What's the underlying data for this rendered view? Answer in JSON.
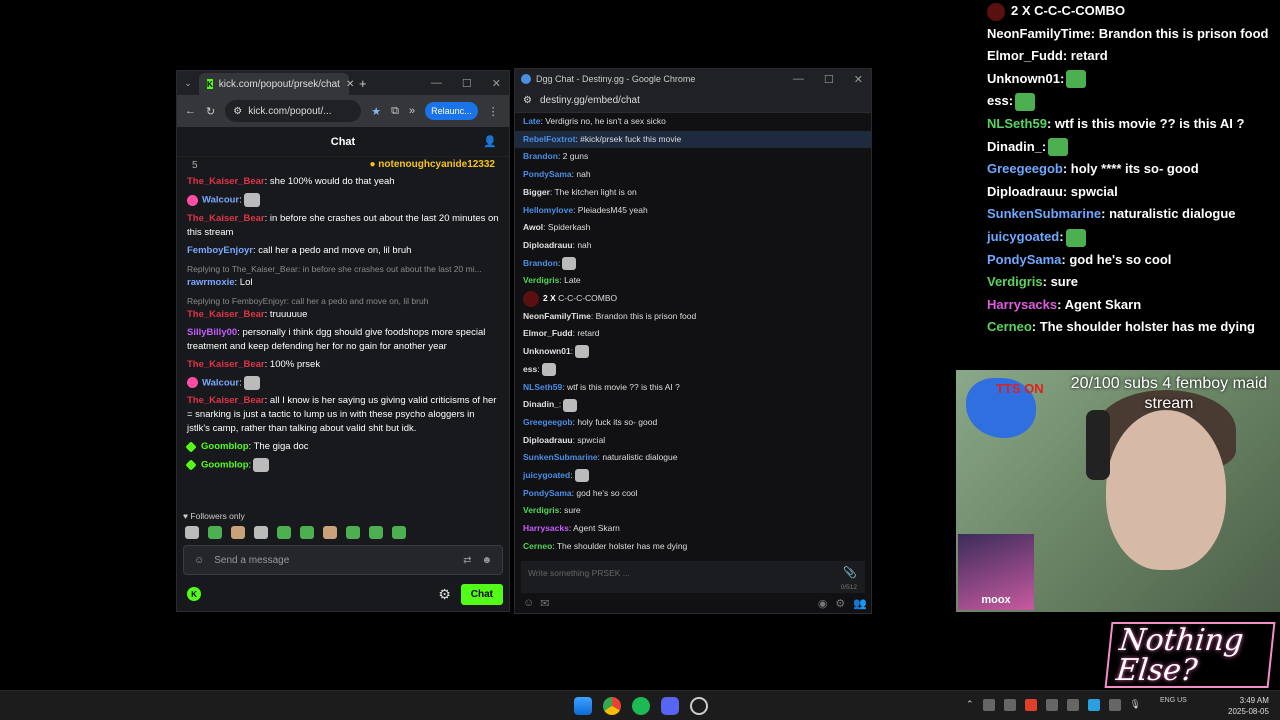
{
  "kick": {
    "tab_title": "kick.com/popout/prsek/chat",
    "url": "kick.com/popout/...",
    "relaunch_label": "Relaunc...",
    "chat_title": "Chat",
    "pinned_count": "5",
    "pinned_user": "notenoughcyanide12332",
    "messages": [
      {
        "user": "The_Kaiser_Bear",
        "text": ": she 100% would do that yeah",
        "color": "#e0334a",
        "reply": ""
      },
      {
        "user": "Walcour",
        "text": ":",
        "color": "#7aa8ff",
        "reply": ""
      },
      {
        "user": "The_Kaiser_Bear",
        "text": ": in before she crashes out about the last 20 minutes on this stream",
        "color": "#e0334a",
        "reply": ""
      },
      {
        "user": "FemboyEnjoyr",
        "text": ": call her a pedo and move on, lil bruh",
        "color": "#7aa8ff",
        "reply": ""
      },
      {
        "user": "rawrmoxie",
        "text": ": Lol",
        "color": "#7aa8ff",
        "reply": "Replying to The_Kaiser_Bear: in before she crashes out about the last 20 mi..."
      },
      {
        "user": "The_Kaiser_Bear",
        "text": ": truuuuue",
        "color": "#e0334a",
        "reply": "Replying to FemboyEnjoyr: call her a pedo and move on, lil bruh"
      },
      {
        "user": "SillyBilly00",
        "text": ": personally i think dgg should give foodshops more special treatment and keep defending her for no gain for another year",
        "color": "#c55cff",
        "reply": ""
      },
      {
        "user": "The_Kaiser_Bear",
        "text": ": 100% prsek",
        "color": "#e0334a",
        "reply": ""
      },
      {
        "user": "Walcour",
        "text": ":",
        "color": "#7aa8ff",
        "reply": ""
      },
      {
        "user": "The_Kaiser_Bear",
        "text": ": all I know is her saying us giving valid criticisms of her = snarking is just a tactic to lump us in with these psycho aloggers in jstlk's camp, rather than talking about valid shit but idk.",
        "color": "#e0334a",
        "reply": ""
      },
      {
        "user": "Goomblop",
        "text": ": The giga doc",
        "color": "#53fc18",
        "reply": ""
      },
      {
        "user": "Goomblop",
        "text": ":",
        "color": "#53fc18",
        "reply": ""
      }
    ],
    "followers_only": "Followers only",
    "input_placeholder": "Send a message",
    "chat_button": "Chat"
  },
  "dgg": {
    "window_title": "Dgg Chat - Destiny.gg - Google Chrome",
    "url": "destiny.gg/embed/chat",
    "messages": [
      {
        "user": "Late",
        "text": ": Verdigris no, he isn't a sex sicko",
        "color": "#4a8ee6",
        "hl": false
      },
      {
        "user": "RebelFoxtrot",
        "text": ": #kick/prsek fuck this movie",
        "color": "#4a8ee6",
        "hl": true
      },
      {
        "user": "Brandon",
        "text": ": 2 guns",
        "color": "#4a8ee6",
        "hl": false
      },
      {
        "user": "PondySama",
        "text": ": nah",
        "color": "#4a8ee6",
        "hl": false
      },
      {
        "user": "Bigger",
        "text": ": The kitchen light is on",
        "color": "#e0e0e0",
        "hl": false
      },
      {
        "user": "Hellomylove",
        "text": ": PleiadesM45 yeah",
        "color": "#4a8ee6",
        "hl": false
      },
      {
        "user": "Awol",
        "text": ": Spiderkash",
        "color": "#e0e0e0",
        "hl": false
      },
      {
        "user": "Diploadrauu",
        "text": ": nah",
        "color": "#e0e0e0",
        "hl": false
      },
      {
        "user": "Brandon",
        "text": ":",
        "color": "#4a8ee6",
        "hl": false
      },
      {
        "user": "Verdigris",
        "text": ": Late",
        "color": "#53d45a",
        "hl": false
      },
      {
        "user": "2 X",
        "text": " C-C-C-COMBO",
        "color": "#ffffff",
        "hl": false,
        "combo": true
      },
      {
        "user": "NeonFamilyTime",
        "text": ": Brandon this is prison food",
        "color": "#e0e0e0",
        "hl": false
      },
      {
        "user": "Elmor_Fudd",
        "text": ": retard",
        "color": "#e0e0e0",
        "hl": false
      },
      {
        "user": "Unknown01",
        "text": ":",
        "color": "#e0e0e0",
        "hl": false
      },
      {
        "user": "ess",
        "text": ":",
        "color": "#e0e0e0",
        "hl": false
      },
      {
        "user": "NLSeth59",
        "text": ": wtf is this movie ?? is this AI ?",
        "color": "#4a8ee6",
        "hl": false
      },
      {
        "user": "Dinadin_",
        "text": ":",
        "color": "#e0e0e0",
        "hl": false
      },
      {
        "user": "Greegeegob",
        "text": ": holy fuck its so- good",
        "color": "#4a8ee6",
        "hl": false
      },
      {
        "user": "Diploadrauu",
        "text": ": spwcial",
        "color": "#e0e0e0",
        "hl": false
      },
      {
        "user": "SunkenSubmarine",
        "text": ": naturalistic dialogue",
        "color": "#4a8ee6",
        "hl": false
      },
      {
        "user": "juicygoated",
        "text": ":",
        "color": "#4a8ee6",
        "hl": false
      },
      {
        "user": "PondySama",
        "text": ": god he's so cool",
        "color": "#4a8ee6",
        "hl": false
      },
      {
        "user": "Verdigris",
        "text": ": sure",
        "color": "#53d45a",
        "hl": false
      },
      {
        "user": "Harrysacks",
        "text": ": Agent Skarn",
        "color": "#c55cff",
        "hl": false
      },
      {
        "user": "Cerneo",
        "text": ": The shoulder holster has me dying",
        "color": "#53d45a",
        "hl": false
      }
    ],
    "input_placeholder": "Write something PRSEK ...",
    "char_count": "0/512"
  },
  "overlay": {
    "messages": [
      {
        "user": "2 X",
        "text": " C-C-C-COMBO",
        "color": "#ffffff",
        "combo": true
      },
      {
        "user": "NeonFamilyTime",
        "text": ": Brandon this is prison food",
        "color": "#ffffff"
      },
      {
        "user": "Elmor_Fudd",
        "text": ": retard",
        "color": "#ffffff"
      },
      {
        "user": "Unknown01",
        "text": ":",
        "color": "#ffffff"
      },
      {
        "user": "ess",
        "text": ":",
        "color": "#ffffff"
      },
      {
        "user": "NLSeth59",
        "text": ": wtf is this movie ?? is this AI ?",
        "color": "#5bd45e"
      },
      {
        "user": "Dinadin_",
        "text": ":",
        "color": "#ffffff"
      },
      {
        "user": "Greegeegob",
        "text": ": holy **** its so- good",
        "color": "#6fa8ff"
      },
      {
        "user": "Diploadrauu",
        "text": ": spwcial",
        "color": "#ffffff"
      },
      {
        "user": "SunkenSubmarine",
        "text": ": naturalistic dialogue",
        "color": "#6fa8ff"
      },
      {
        "user": "juicygoated",
        "text": ":",
        "color": "#6fa8ff"
      },
      {
        "user": "PondySama",
        "text": ": god he's so cool",
        "color": "#6fa8ff"
      },
      {
        "user": "Verdigris",
        "text": ": sure",
        "color": "#5bd45e"
      },
      {
        "user": "Harrysacks",
        "text": ": Agent Skarn",
        "color": "#e05ce0"
      },
      {
        "user": "Cerneo",
        "text": ": The shoulder holster has me dying",
        "color": "#5bd45e"
      }
    ]
  },
  "cam": {
    "tts_label": "TTS ON",
    "subs_text": "20/100 subs 4 femboy maid stream",
    "pip_name": "moox"
  },
  "logo_text": "Nothing Else?",
  "taskbar": {
    "lang": "ENG US",
    "time": "3:49 AM",
    "date": "2025-08-05"
  }
}
